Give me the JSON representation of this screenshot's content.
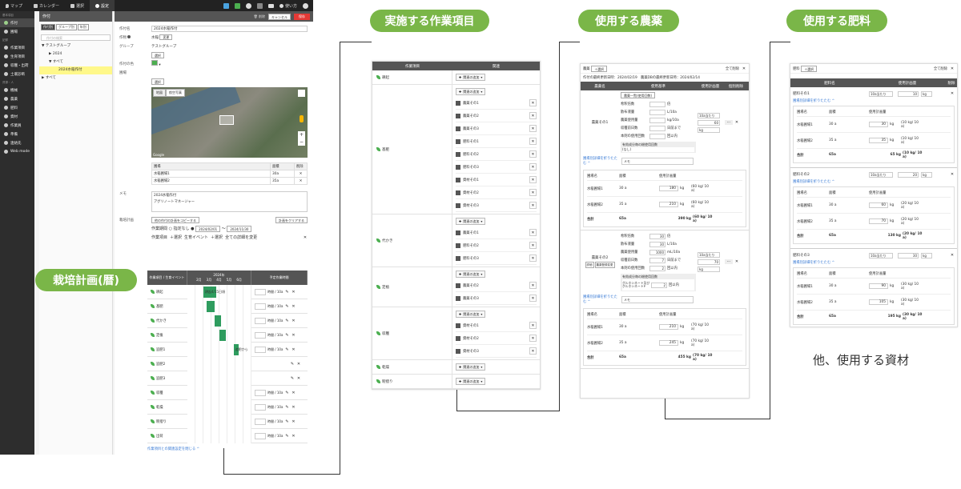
{
  "labels": {
    "calendar": "栽培計画(暦)",
    "works": "実施する作業項目",
    "pesticides": "使用する農薬",
    "fertilizers": "使用する肥料",
    "other": "他、使用する資材"
  },
  "app": {
    "topbar": {
      "map": "マップ",
      "calendar": "カレンダー",
      "select": "選択",
      "settings": "設定",
      "help": "使い方"
    },
    "leftnav": {
      "section1": "基本項目",
      "items": [
        "作付",
        "圃場"
      ],
      "section2": "記録",
      "items2": [
        "作業項目",
        "生育項目",
        "収穫・出荷",
        "土壌診断"
      ],
      "section3": "資源・人",
      "items3": [
        "機械",
        "農薬",
        "肥料",
        "資材",
        "作業員",
        "準備",
        "連絡先",
        "Web mode"
      ]
    },
    "tree": {
      "header": "作付",
      "tabs": [
        "作付別",
        "グループ別",
        "年別"
      ],
      "search_placeholder": "作付の検索",
      "group": "テストグループ",
      "years": [
        "2024",
        "すべて"
      ],
      "selected": "2024水稲作付",
      "all": "すべて"
    },
    "form": {
      "delete": "削除",
      "cancel": "キャンセル",
      "save": "保存",
      "name_label": "作付名",
      "name_value": "2024水稲作付",
      "crop_label": "作物",
      "crop_value": "水稲",
      "crop_change": "変更",
      "group_label": "グループ",
      "group_value": "テストグループ",
      "select_btn": "選択",
      "color_label": "作付の色",
      "field_label": "圃場",
      "map_tabs": [
        "地図",
        "航空写真"
      ],
      "map_credit": "Google",
      "field_table_header": [
        "圃場",
        "面積",
        "削除"
      ],
      "field_rows": [
        {
          "name": "水稲圃場1",
          "area": "30a"
        },
        {
          "name": "水稲圃場2",
          "area": "35a"
        }
      ],
      "memo_label": "メモ",
      "memo_lines": [
        "2024水稲作付",
        "アグリノートマネージャー"
      ],
      "plan_label": "栽培計画",
      "copy_btn": "他の作付の計画をコピーする",
      "clear_btn": "計画をクリアする",
      "period_label": "作業期間",
      "period_none": "指定なし",
      "period_from": "2024/02/01",
      "period_to": "2024/11/30",
      "plan_tabs": [
        "作業項目",
        "＋選択",
        "生育イベント",
        "＋選択",
        "全ての詳細を変更"
      ]
    },
    "gantt": {
      "col_work": "作業項目 / 生育イベント",
      "year": "2024年",
      "months": [
        "2月",
        "3月",
        "4月",
        "5月",
        "6月"
      ],
      "col_time": "予定作業時間",
      "unit": "時間 / 10a",
      "rows": [
        {
          "name": "耕起",
          "bar": [
            0.25,
            0.45
          ],
          "bar_label": "耕起4/15日頃",
          "time": true
        },
        {
          "name": "基肥",
          "bar": [
            0.3,
            0.42
          ],
          "bar_label": "",
          "time": true
        },
        {
          "name": "代かき",
          "bar": [
            0.42,
            0.53
          ],
          "bar_label": "",
          "time": true
        },
        {
          "name": "定植",
          "bar": [
            0.5,
            0.6
          ],
          "bar_label": "",
          "time": true
        },
        {
          "name": "追肥1",
          "bar": [
            0.72,
            0.8
          ],
          "bar_label": "追肥から",
          "time": true
        },
        {
          "name": "追肥2",
          "bar": null,
          "bar_label": "",
          "time": false
        },
        {
          "name": "追肥3",
          "bar": null,
          "bar_label": "",
          "time": false
        },
        {
          "name": "収穫",
          "bar": null,
          "bar_label": "",
          "time": true
        },
        {
          "name": "乾燥",
          "bar": null,
          "bar_label": "",
          "time": true
        },
        {
          "name": "籾摺り",
          "bar": null,
          "bar_label": "",
          "time": true
        },
        {
          "name": "出荷",
          "bar": null,
          "bar_label": "",
          "time": true
        }
      ],
      "footer_link": "作業項目との関連設定を閉じる ^"
    }
  },
  "works_panel": {
    "headers": [
      "作業項目",
      "関連"
    ],
    "add_label": "関連の追加",
    "rows": [
      {
        "name": "耕起",
        "items": []
      },
      {
        "name": "基肥",
        "items": [
          "農薬その1",
          "農薬その2",
          "農薬その3",
          "肥料その1",
          "肥料その2",
          "肥料その3",
          "資材その1",
          "資材その2",
          "資材その3"
        ]
      },
      {
        "name": "代かき",
        "items": [
          "農薬その1",
          "肥料その2",
          "肥料その3"
        ]
      },
      {
        "name": "定植",
        "items": [
          "農薬その2",
          "農薬その3"
        ]
      },
      {
        "name": "収穫",
        "items": [
          "資材その1",
          "資材その2",
          "資材その3"
        ]
      },
      {
        "name": "乾燥",
        "items": []
      },
      {
        "name": "籾摺り",
        "items": []
      },
      {
        "name": "出荷",
        "items": []
      }
    ]
  },
  "pesticide_panel": {
    "title": "農薬",
    "select": "＋選択",
    "close_all": "全て削除",
    "info": "作付の最終更新日時：2024/02/19　農薬DBの最終更新日時：2024/02/14",
    "headers": [
      "農薬名",
      "使用基準",
      "使用計画量",
      "個別削除"
    ],
    "basis_btn": "農薬一覧(使用回数)",
    "agents": [
      {
        "name": "農薬その1",
        "fields": [
          {
            "label": "希釈倍数",
            "value": "",
            "unit": "倍"
          },
          {
            "label": "散布液量",
            "value": "",
            "unit": "L/10a"
          },
          {
            "label": "農薬使用量",
            "value": "",
            "unit": "kg/10a"
          },
          {
            "label": "収穫前日数",
            "value": "",
            "unit": "日前まで"
          },
          {
            "label": "本剤の使用回数",
            "value": "",
            "unit": "回以内"
          }
        ],
        "ingredient_hdr": "有効成分毎の総使用回数",
        "ingredient_val": "(なし)",
        "plan_unit": "10a当たり",
        "plan_value": "60",
        "plan_kg": "kg",
        "fold_link": "圃場別詳細を折りたたむ ^",
        "memo": "メモ",
        "fields_hdr": [
          "圃場名",
          "面積",
          "使用計画量"
        ],
        "rows": [
          {
            "field": "水稲圃場1",
            "area": "30 a",
            "amount": "180",
            "unit": "kg",
            "per": "(60 kg/ 10 a)"
          },
          {
            "field": "水稲圃場2",
            "area": "35 a",
            "amount": "210",
            "unit": "kg",
            "per": "(60 kg/ 10 a)"
          }
        ],
        "total": {
          "label": "合計",
          "area": "65a",
          "amount": "390 kg",
          "per": "(60 kg/ 10 a)"
        }
      },
      {
        "name": "農薬その2",
        "badges": [
          "詳細",
          "農薬登録変更"
        ],
        "fields": [
          {
            "label": "希釈倍数",
            "value": "30",
            "unit": "倍"
          },
          {
            "label": "散布液量",
            "value": "30",
            "unit": "L/10a"
          },
          {
            "label": "農薬使用量",
            "value": "1000",
            "unit": "mL/10a"
          },
          {
            "label": "収穫前日数",
            "value": "7",
            "unit": "日前まで"
          },
          {
            "label": "本剤の使用回数",
            "value": "2",
            "unit": "回以内"
          }
        ],
        "ingredient_hdr": "有効成分毎の総使用回数",
        "ingredient_name": "グルホシネート及びグルホシネートP",
        "ingredient_val": "2",
        "ingredient_unit": "回以内",
        "plan_unit": "10a当たり",
        "plan_value": "70",
        "plan_kg": "kg",
        "fold_link": "圃場別詳細を折りたたむ ^",
        "memo": "メモ",
        "fields_hdr": [
          "圃場名",
          "面積",
          "使用計画量"
        ],
        "rows": [
          {
            "field": "水稲圃場1",
            "area": "30 a",
            "amount": "210",
            "unit": "kg",
            "per": "(70 kg/ 10 a)"
          },
          {
            "field": "水稲圃場2",
            "area": "35 a",
            "amount": "245",
            "unit": "kg",
            "per": "(70 kg/ 10 a)"
          }
        ],
        "total": {
          "label": "合計",
          "area": "65a",
          "amount": "455 kg",
          "per": "(70 kg/ 10 a)"
        }
      }
    ]
  },
  "fertilizer_panel": {
    "title": "肥料",
    "select": "＋選択",
    "close_all": "全て削除",
    "headers": [
      "肥料名",
      "使用計画量",
      "削除"
    ],
    "fert": [
      {
        "name": "肥料その1",
        "plan_unit": "10a当たり",
        "plan_value": "10",
        "plan_kg": "kg",
        "fold_link": "圃場別詳細を折りたたむ ^",
        "fields_hdr": [
          "圃場名",
          "面積",
          "使用計画量"
        ],
        "rows": [
          {
            "field": "水稲圃場1",
            "area": "30 a",
            "amount": "30",
            "unit": "kg",
            "per": "(10 kg/ 10 a)"
          },
          {
            "field": "水稲圃場2",
            "area": "35 a",
            "amount": "35",
            "unit": "kg",
            "per": "(10 kg/ 10 a)"
          }
        ],
        "total": {
          "label": "合計",
          "area": "65a",
          "amount": "65 kg",
          "per": "(10 kg/ 10 a)"
        }
      },
      {
        "name": "肥料その2",
        "plan_unit": "10a当たり",
        "plan_value": "20",
        "plan_kg": "kg",
        "fold_link": "圃場別詳細を折りたたむ ^",
        "fields_hdr": [
          "圃場名",
          "面積",
          "使用計画量"
        ],
        "rows": [
          {
            "field": "水稲圃場1",
            "area": "30 a",
            "amount": "60",
            "unit": "kg",
            "per": "(20 kg/ 10 a)"
          },
          {
            "field": "水稲圃場2",
            "area": "35 a",
            "amount": "70",
            "unit": "kg",
            "per": "(20 kg/ 10 a)"
          }
        ],
        "total": {
          "label": "合計",
          "area": "65a",
          "amount": "130 kg",
          "per": "(20 kg/ 10 a)"
        }
      },
      {
        "name": "肥料その3",
        "plan_unit": "10a当たり",
        "plan_value": "30",
        "plan_kg": "kg",
        "fold_link": "圃場別詳細を折りたたむ ^",
        "fields_hdr": [
          "圃場名",
          "面積",
          "使用計画量"
        ],
        "rows": [
          {
            "field": "水稲圃場1",
            "area": "30 a",
            "amount": "90",
            "unit": "kg",
            "per": "(30 kg/ 10 a)"
          },
          {
            "field": "水稲圃場2",
            "area": "35 a",
            "amount": "105",
            "unit": "kg",
            "per": "(30 kg/ 10 a)"
          }
        ],
        "total": {
          "label": "合計",
          "area": "65a",
          "amount": "195 kg",
          "per": "(30 kg/ 10 a)"
        }
      }
    ]
  },
  "colors": {
    "accent": "#7ab648",
    "bar": "#2e9c5e",
    "danger": "#e53935",
    "header": "#555555",
    "selected": "#fff88a"
  }
}
